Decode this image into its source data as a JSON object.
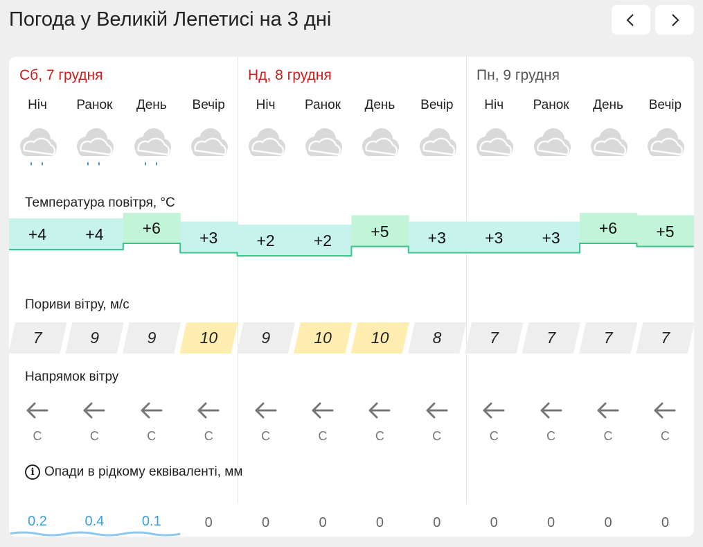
{
  "page": {
    "title": "Погода у Великій Лепетисі на 3 дні",
    "prev_icon": "chevron-left-icon",
    "next_icon": "chevron-right-icon"
  },
  "colors": {
    "weekend_day": "#cc1f1f",
    "weekday_day": "#555555",
    "temp_low": "#c7f3ec",
    "temp_high": "#c2f5d8",
    "gust_normal": "#eeeeee",
    "gust_strong": "#ffeeb0",
    "precip_text": "#3a9fe0"
  },
  "days": [
    {
      "label": "Сб, 7 грудня",
      "weekend": true
    },
    {
      "label": "Нд, 8 грудня",
      "weekend": true
    },
    {
      "label": "Пн, 9 грудня",
      "weekend": false
    }
  ],
  "periods": [
    {
      "day": 0,
      "label": "Ніч",
      "icon": "cloud-light-rain-icon",
      "temp": "+4",
      "temp_value": 4,
      "gust": "7",
      "dir": "С",
      "precip": "0.2"
    },
    {
      "day": 0,
      "label": "Ранок",
      "icon": "cloud-light-rain-icon",
      "temp": "+4",
      "temp_value": 4,
      "gust": "9",
      "dir": "С",
      "precip": "0.4"
    },
    {
      "day": 0,
      "label": "День",
      "icon": "cloud-light-rain-icon",
      "temp": "+6",
      "temp_value": 6,
      "gust": "9",
      "dir": "С",
      "precip": "0.1"
    },
    {
      "day": 0,
      "label": "Вечір",
      "icon": "cloud-icon",
      "temp": "+3",
      "temp_value": 3,
      "gust": "10",
      "dir": "С",
      "precip": "0"
    },
    {
      "day": 1,
      "label": "Ніч",
      "icon": "cloud-icon",
      "temp": "+2",
      "temp_value": 2,
      "gust": "9",
      "dir": "С",
      "precip": "0"
    },
    {
      "day": 1,
      "label": "Ранок",
      "icon": "cloud-icon",
      "temp": "+2",
      "temp_value": 2,
      "gust": "10",
      "dir": "С",
      "precip": "0"
    },
    {
      "day": 1,
      "label": "День",
      "icon": "cloud-icon",
      "temp": "+5",
      "temp_value": 5,
      "gust": "10",
      "dir": "С",
      "precip": "0"
    },
    {
      "day": 1,
      "label": "Вечір",
      "icon": "cloud-icon",
      "temp": "+3",
      "temp_value": 3,
      "gust": "8",
      "dir": "С",
      "precip": "0"
    },
    {
      "day": 2,
      "label": "Ніч",
      "icon": "cloud-icon",
      "temp": "+3",
      "temp_value": 3,
      "gust": "7",
      "dir": "С",
      "precip": "0"
    },
    {
      "day": 2,
      "label": "Ранок",
      "icon": "cloud-icon",
      "temp": "+3",
      "temp_value": 3,
      "gust": "7",
      "dir": "С",
      "precip": "0"
    },
    {
      "day": 2,
      "label": "День",
      "icon": "cloud-icon",
      "temp": "+6",
      "temp_value": 6,
      "gust": "7",
      "dir": "С",
      "precip": "0"
    },
    {
      "day": 2,
      "label": "Вечір",
      "icon": "cloud-icon",
      "temp": "+5",
      "temp_value": 5,
      "gust": "7",
      "dir": "С",
      "precip": "0"
    }
  ],
  "sections": {
    "temperature": "Температура повітря, °C",
    "gusts": "Пориви вітру, м/с",
    "direction": "Напрямок вітру",
    "precip": "Опади в рідкому еквіваленті, мм",
    "precip_icon": "info-icon",
    "direction_icon": "arrow-left-icon"
  }
}
